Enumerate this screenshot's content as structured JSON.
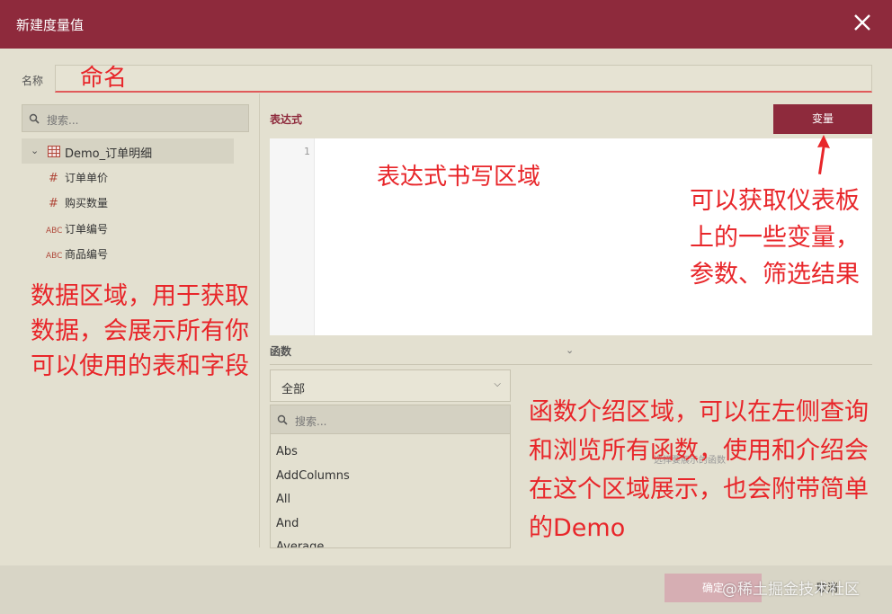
{
  "dialog": {
    "title": "新建度量值",
    "name_label": "名称"
  },
  "left_panel": {
    "search_placeholder": "搜索...",
    "table_name": "Demo_订单明细",
    "fields": [
      {
        "type": "number",
        "icon": "#",
        "label": "订单单价"
      },
      {
        "type": "number",
        "icon": "#",
        "label": "购买数量"
      },
      {
        "type": "text",
        "icon": "ABC",
        "label": "订单编号"
      },
      {
        "type": "text",
        "icon": "ABC",
        "label": "商品编号"
      }
    ]
  },
  "expression": {
    "label": "表达式",
    "variable_button": "变量",
    "line_number": "1"
  },
  "functions": {
    "label": "函数",
    "selected_category": "全部",
    "search_placeholder": "搜索...",
    "items": [
      "Abs",
      "AddColumns",
      "All",
      "And",
      "Average"
    ],
    "hint": "选择要展示的函数"
  },
  "footer": {
    "ok_label": "确定",
    "cancel_label": "取消"
  },
  "annotations": {
    "name": "命名",
    "expression_area": "表达式书写区域",
    "variables": "可以获取仪表板上的一些变量，参数、筛选结果",
    "data_area": "数据区域，用于获取数据，会展示所有你可以使用的表和字段",
    "functions_area": "函数介绍区域，可以在左侧查询和浏览所有函数，使用和介绍会在这个区域展示，也会附带简单的Demo",
    "color": "#e8262a"
  },
  "watermark": "@稀土掘金技术社区",
  "colors": {
    "primary": "#8e2a3c",
    "background": "#e3e0d0",
    "accent_line": "#e05a5a"
  }
}
